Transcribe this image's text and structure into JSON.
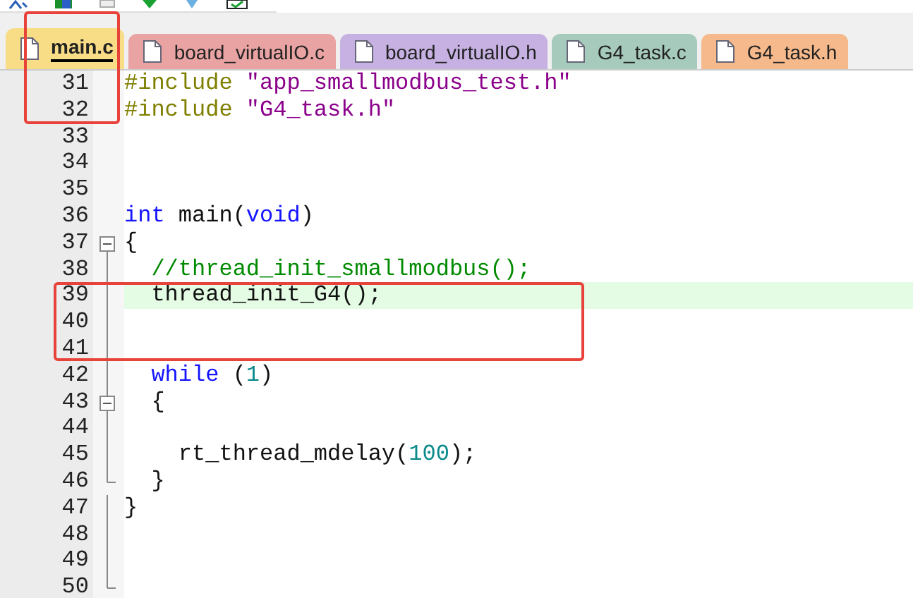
{
  "tabs": [
    {
      "label": "main.c",
      "selected": true,
      "color": "#f8dc86"
    },
    {
      "label": "board_virtualIO.c",
      "selected": false,
      "color": "#eaa3a3"
    },
    {
      "label": "board_virtualIO.h",
      "selected": false,
      "color": "#c6b1e2"
    },
    {
      "label": "G4_task.c",
      "selected": false,
      "color": "#a6cbbd"
    },
    {
      "label": "G4_task.h",
      "selected": false,
      "color": "#f5b98c"
    }
  ],
  "lines": [
    {
      "number": "31",
      "current": false,
      "fold_toggle": false,
      "in_fold": false,
      "fold_end": false,
      "tokens": [
        {
          "kind": "preproc",
          "text": "#include "
        },
        {
          "kind": "string",
          "text": "\"app_smallmodbus_test.h\""
        }
      ]
    },
    {
      "number": "32",
      "current": false,
      "fold_toggle": false,
      "in_fold": false,
      "fold_end": false,
      "tokens": [
        {
          "kind": "preproc",
          "text": "#include "
        },
        {
          "kind": "string",
          "text": "\"G4_task.h\""
        }
      ]
    },
    {
      "number": "33",
      "current": false,
      "fold_toggle": false,
      "in_fold": false,
      "fold_end": false
    },
    {
      "number": "34",
      "current": false,
      "fold_toggle": false,
      "in_fold": false,
      "fold_end": false
    },
    {
      "number": "35",
      "current": false,
      "fold_toggle": false,
      "in_fold": false,
      "fold_end": false
    },
    {
      "number": "36",
      "current": false,
      "fold_toggle": false,
      "in_fold": false,
      "fold_end": false,
      "tokens": [
        {
          "kind": "keyword",
          "text": "int"
        },
        {
          "kind": "plain",
          "text": " main("
        },
        {
          "kind": "keyword",
          "text": "void"
        },
        {
          "kind": "plain",
          "text": ")"
        }
      ]
    },
    {
      "number": "37",
      "current": false,
      "fold_toggle": true,
      "in_fold": false,
      "fold_end": false,
      "tokens": [
        {
          "kind": "plain",
          "text": "{"
        }
      ]
    },
    {
      "number": "38",
      "current": false,
      "fold_toggle": false,
      "in_fold": true,
      "fold_end": false,
      "tokens": [
        {
          "kind": "comment",
          "text": "  //thread_init_smallmodbus();"
        }
      ]
    },
    {
      "number": "39",
      "current": true,
      "fold_toggle": false,
      "in_fold": true,
      "fold_end": false,
      "tokens": [
        {
          "kind": "plain",
          "text": "  thread_init_G4();"
        }
      ]
    },
    {
      "number": "40",
      "current": false,
      "fold_toggle": false,
      "in_fold": true,
      "fold_end": false
    },
    {
      "number": "41",
      "current": false,
      "fold_toggle": false,
      "in_fold": true,
      "fold_end": false
    },
    {
      "number": "42",
      "current": false,
      "fold_toggle": false,
      "in_fold": true,
      "fold_end": false,
      "tokens": [
        {
          "kind": "keyword",
          "text": "  while"
        },
        {
          "kind": "plain",
          "text": " ("
        },
        {
          "kind": "number",
          "text": "1"
        },
        {
          "kind": "plain",
          "text": ")"
        }
      ]
    },
    {
      "number": "43",
      "current": false,
      "fold_toggle": true,
      "in_fold": true,
      "fold_end": false,
      "tokens": [
        {
          "kind": "plain",
          "text": "  {"
        }
      ]
    },
    {
      "number": "44",
      "current": false,
      "fold_toggle": false,
      "in_fold": true,
      "fold_end": false
    },
    {
      "number": "45",
      "current": false,
      "fold_toggle": false,
      "in_fold": true,
      "fold_end": false,
      "tokens": [
        {
          "kind": "plain",
          "text": "    rt_thread_mdelay("
        },
        {
          "kind": "number",
          "text": "100"
        },
        {
          "kind": "plain",
          "text": ");"
        }
      ]
    },
    {
      "number": "46",
      "current": false,
      "fold_toggle": false,
      "in_fold": true,
      "fold_end": true,
      "tokens": [
        {
          "kind": "plain",
          "text": "  }"
        }
      ]
    },
    {
      "number": "47",
      "current": false,
      "fold_toggle": false,
      "in_fold": true,
      "fold_end": false,
      "tokens": [
        {
          "kind": "plain",
          "text": "}"
        }
      ]
    },
    {
      "number": "48",
      "current": false,
      "fold_toggle": false,
      "in_fold": true,
      "fold_end": false
    },
    {
      "number": "49",
      "current": false,
      "fold_toggle": false,
      "in_fold": true,
      "fold_end": false
    },
    {
      "number": "50",
      "current": false,
      "fold_toggle": false,
      "in_fold": true,
      "fold_end": true
    }
  ],
  "annotations": {
    "tab_and_gutter_box": true,
    "code_lines_box": true
  }
}
